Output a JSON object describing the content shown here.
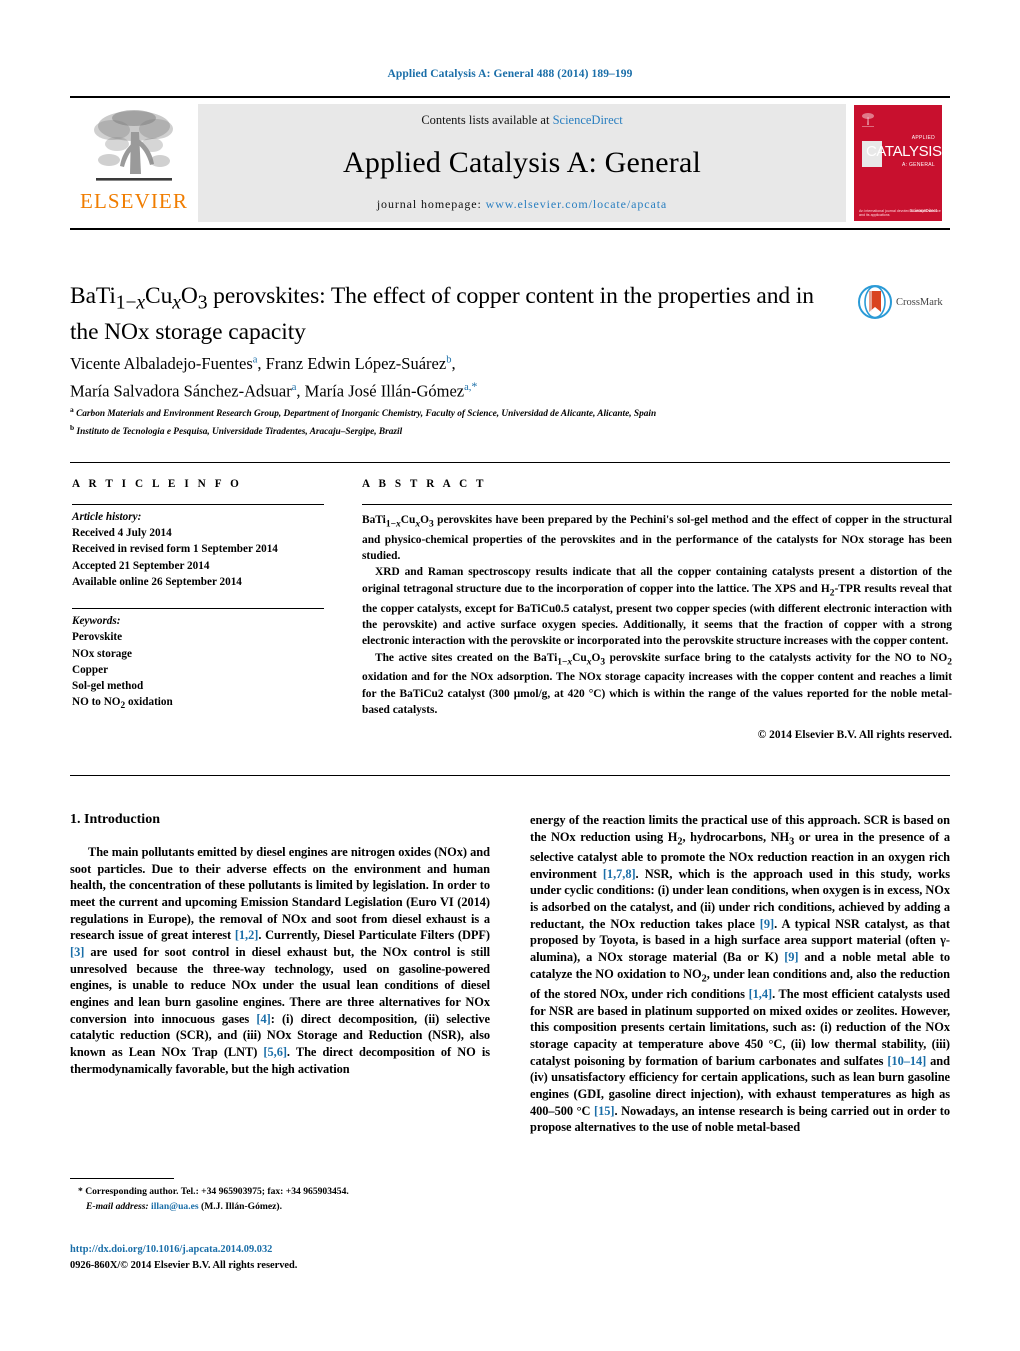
{
  "running_head": "Applied Catalysis A: General 488 (2014) 189–199",
  "masthead": {
    "publisher_wordmark": "ELSEVIER",
    "contents_prefix": "Contents lists available at ",
    "contents_link": "ScienceDirect",
    "journal_title": "Applied Catalysis A: General",
    "homepage_prefix": "journal homepage: ",
    "homepage_url": "www.elsevier.com/locate/apcata",
    "cover": {
      "title": "CATALYSIS",
      "top_label": "APPLIED",
      "bottom_label": "A: GENERAL",
      "footer_left": "An international journal devoted to catalytic science and its applications",
      "footer_right": "Available online at\nScienceDirect"
    }
  },
  "crossmark": {
    "label": "CrossMark"
  },
  "article": {
    "title": "BaTi1−xCuxO3 perovskites: The effect of copper content in the properties and in the NOx storage capacity",
    "authors_line1": "Vicente Albaladejo-Fuentes",
    "authors_line1_b": "Franz Edwin López-Suárez",
    "authors_line2": "María Salvadora Sánchez-Adsuar",
    "authors_line2_b": "María José Illán-Gómez",
    "affiliations": [
      "Carbon Materials and Environment Research Group, Department of Inorganic Chemistry, Faculty of Science, Universidad de Alicante, Alicante, Spain",
      "Instituto de Tecnologia e Pesquisa, Universidade Tiradentes, Aracaju–Sergipe, Brazil"
    ]
  },
  "article_info": {
    "heading": "A R T I C L E   I N F O",
    "history_label": "Article history:",
    "history": [
      "Received 4 July 2014",
      "Received in revised form 1 September 2014",
      "Accepted 21 September 2014",
      "Available online 26 September 2014"
    ],
    "keywords_label": "Keywords:",
    "keywords": [
      "Perovskite",
      "NOx storage",
      "Copper",
      "Sol-gel method",
      "NO to NO2 oxidation"
    ]
  },
  "abstract": {
    "heading": "A B S T R A C T",
    "paragraphs": [
      "BaTi1−xCuxO3 perovskites have been prepared by the Pechini's sol-gel method and the effect of copper in the structural and physico-chemical properties of the perovskites and in the performance of the catalysts for NOx storage has been studied.",
      "XRD and Raman spectroscopy results indicate that all the copper containing catalysts present a distortion of the original tetragonal structure due to the incorporation of copper into the lattice. The XPS and H2-TPR results reveal that the copper catalysts, except for BaTiCu0.5 catalyst, present two copper species (with different electronic interaction with the perovskite) and active surface oxygen species. Additionally, it seems that the fraction of copper with a strong electronic interaction with the perovskite or incorporated into the perovskite structure increases with the copper content.",
      "The active sites created on the BaTi1−xCuxO3 perovskite surface bring to the catalysts activity for the NO to NO2 oxidation and for the NOx adsorption. The NOx storage capacity increases with the copper content and reaches a limit for the BaTiCu2 catalyst (300 μmol/g, at 420 °C) which is within the range of the values reported for the noble metal-based catalysts."
    ],
    "copyright": "© 2014 Elsevier B.V. All rights reserved."
  },
  "introduction": {
    "heading": "1.  Introduction",
    "left_paragraph": "The main pollutants emitted by diesel engines are nitrogen oxides (NOx) and soot particles. Due to their adverse effects on the environment and human health, the concentration of these pollutants is limited by legislation. In order to meet the current and upcoming Emission Standard Legislation (Euro VI (2014) regulations in Europe), the removal of NOx and soot from diesel exhaust is a research issue of great interest [1,2]. Currently, Diesel Particulate Filters (DPF) [3] are used for soot control in diesel exhaust but, the NOx control is still unresolved because the three-way technology, used on gasoline-powered engines, is unable to reduce NOx under the usual lean conditions of diesel engines and lean burn gasoline engines. There are three alternatives for NOx conversion into innocuous gases [4]: (i) direct decomposition, (ii) selective catalytic reduction (SCR), and (iii) NOx Storage and Reduction (NSR), also known as Lean NOx Trap (LNT) [5,6]. The direct decomposition of NO is thermodynamically favorable, but the high activation",
    "right_paragraph": "energy of the reaction limits the practical use of this approach. SCR is based on the NOx reduction using H2, hydrocarbons, NH3 or urea in the presence of a selective catalyst able to promote the NOx reduction reaction in an oxygen rich environment [1,7,8]. NSR, which is the approach used in this study, works under cyclic conditions: (i) under lean conditions, when oxygen is in excess, NOx is adsorbed on the catalyst, and (ii) under rich conditions, achieved by adding a reductant, the NOx reduction takes place [9]. A typical NSR catalyst, as that proposed by Toyota, is based in a high surface area support material (often γ-alumina), a NOx storage material (Ba or K) [9] and a noble metal able to catalyze the NO oxidation to NO2, under lean conditions and, also the reduction of the stored NOx, under rich conditions [1,4]. The most efficient catalysts used for NSR are based in platinum supported on mixed oxides or zeolites. However, this composition presents certain limitations, such as: (i) reduction of the NOx storage capacity at temperature above 450 °C, (ii) low thermal stability, (iii) catalyst poisoning by formation of barium carbonates and sulfates [10–14] and (iv) unsatisfactory efficiency for certain applications, such as lean burn gasoline engines (GDI, gasoline direct injection), with exhaust temperatures as high as 400–500 °C [15]. Nowadays, an intense research is being carried out in order to propose alternatives to the use of noble metal-based"
  },
  "footnote": {
    "corresponding": "Corresponding author. Tel.: +34 965903975; fax: +34 965903454.",
    "email_label": "E-mail address:",
    "email": "illan@ua.es",
    "email_owner": "(M.J. Illán-Gómez)."
  },
  "footer": {
    "doi": "http://dx.doi.org/10.1016/j.apcata.2014.09.032",
    "issn_line": "0926-860X/© 2014 Elsevier B.V. All rights reserved."
  },
  "colors": {
    "link": "#1a6ea8",
    "sciencedirect": "#2a7fc0",
    "elsevier_orange": "#f07d00",
    "cover_red": "#c8102e"
  }
}
